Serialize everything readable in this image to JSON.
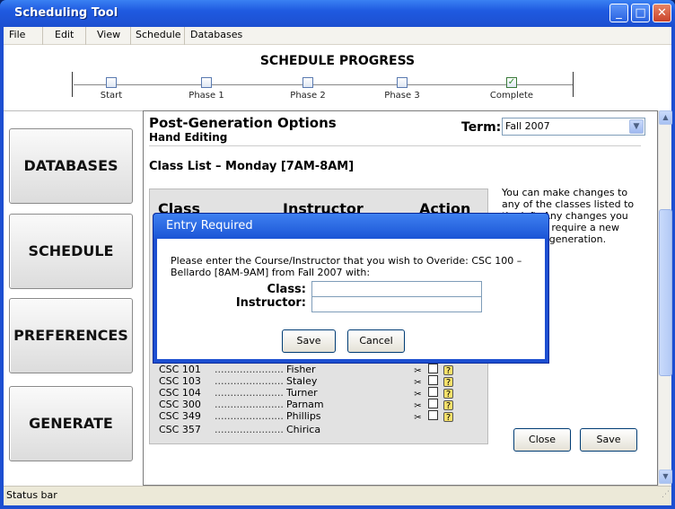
{
  "window": {
    "title": "Scheduling Tool",
    "buttons": [
      "_",
      "□",
      "✕"
    ]
  },
  "menu": [
    "File",
    "Edit",
    "View",
    "Schedule",
    "Databases"
  ],
  "progress": {
    "title": "SCHEDULE PROGRESS",
    "steps": [
      {
        "label": "Start",
        "checked": false
      },
      {
        "label": "Phase 1",
        "checked": false
      },
      {
        "label": "Phase 2",
        "checked": false
      },
      {
        "label": "Phase 3",
        "checked": false
      },
      {
        "label": "Complete",
        "checked": true
      }
    ]
  },
  "nav": [
    "DATABASES",
    "SCHEDULE",
    "PREFERENCES",
    "GENERATE"
  ],
  "panel": {
    "title": "Post-Generation Options",
    "subtitle": "Hand Editing",
    "term_label": "Term:",
    "term_value": "Fall 2007",
    "list_title": "Class List – Monday [7AM-8AM]",
    "headers": [
      "Class",
      "Instructor",
      "Action"
    ],
    "rows": [
      {
        "code": "CSC 101",
        "instructor": "Fisher"
      },
      {
        "code": "CSC 103",
        "instructor": "Staley"
      },
      {
        "code": "CSC 104",
        "instructor": "Turner"
      },
      {
        "code": "CSC 300",
        "instructor": "Parnam"
      },
      {
        "code": "CSC 349",
        "instructor": "Phillips"
      },
      {
        "code": "CSC 357",
        "instructor": "Chirica"
      }
    ],
    "dots": "......................",
    "help_text": "You can make changes to any of the classes listed to the left. Any changes you make will require a new schedule generation.",
    "close_label": "Close",
    "save_label": "Save"
  },
  "dialog": {
    "title": "Entry Required",
    "message": "Please enter the Course/Instructor that you wish to Overide: CSC 100 – Bellardo [8AM-9AM] from Fall 2007 with:",
    "class_label": "Class:",
    "instructor_label": "Instructor:",
    "class_value": "",
    "instructor_value": "",
    "save_label": "Save",
    "cancel_label": "Cancel"
  },
  "status": "Status bar",
  "icons": [
    "scissors-icon",
    "document-icon",
    "question-icon",
    "chevron-down-icon",
    "scroll-up-icon",
    "scroll-down-icon"
  ]
}
